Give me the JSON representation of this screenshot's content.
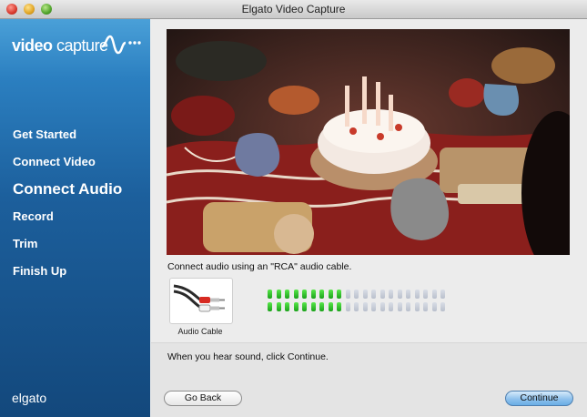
{
  "window": {
    "title": "Elgato Video Capture"
  },
  "sidebar": {
    "logo_bold": "video",
    "logo_text": "capture",
    "logo_icon": "signal-wave-icon",
    "items": [
      {
        "label": "Get Started",
        "active": false
      },
      {
        "label": "Connect Video",
        "active": false
      },
      {
        "label": "Connect Audio",
        "active": true
      },
      {
        "label": "Record",
        "active": false
      },
      {
        "label": "Trim",
        "active": false
      },
      {
        "label": "Finish Up",
        "active": false
      }
    ],
    "brand": "elgato"
  },
  "main": {
    "instruction": "Connect audio using an \"RCA\" audio cable.",
    "cable_label": "Audio Cable",
    "cable_icon": "rca-cable-icon",
    "meter": {
      "segments": 21,
      "left_level": 9,
      "right_level": 9
    },
    "hint": "When you hear sound, click Continue.",
    "back_label": "Go Back",
    "continue_label": "Continue"
  },
  "colors": {
    "sidebar": "#1c5f9c",
    "meter_on": "#2fc22a",
    "meter_off": "#c6cad4",
    "continue": "#8fc1ec"
  }
}
